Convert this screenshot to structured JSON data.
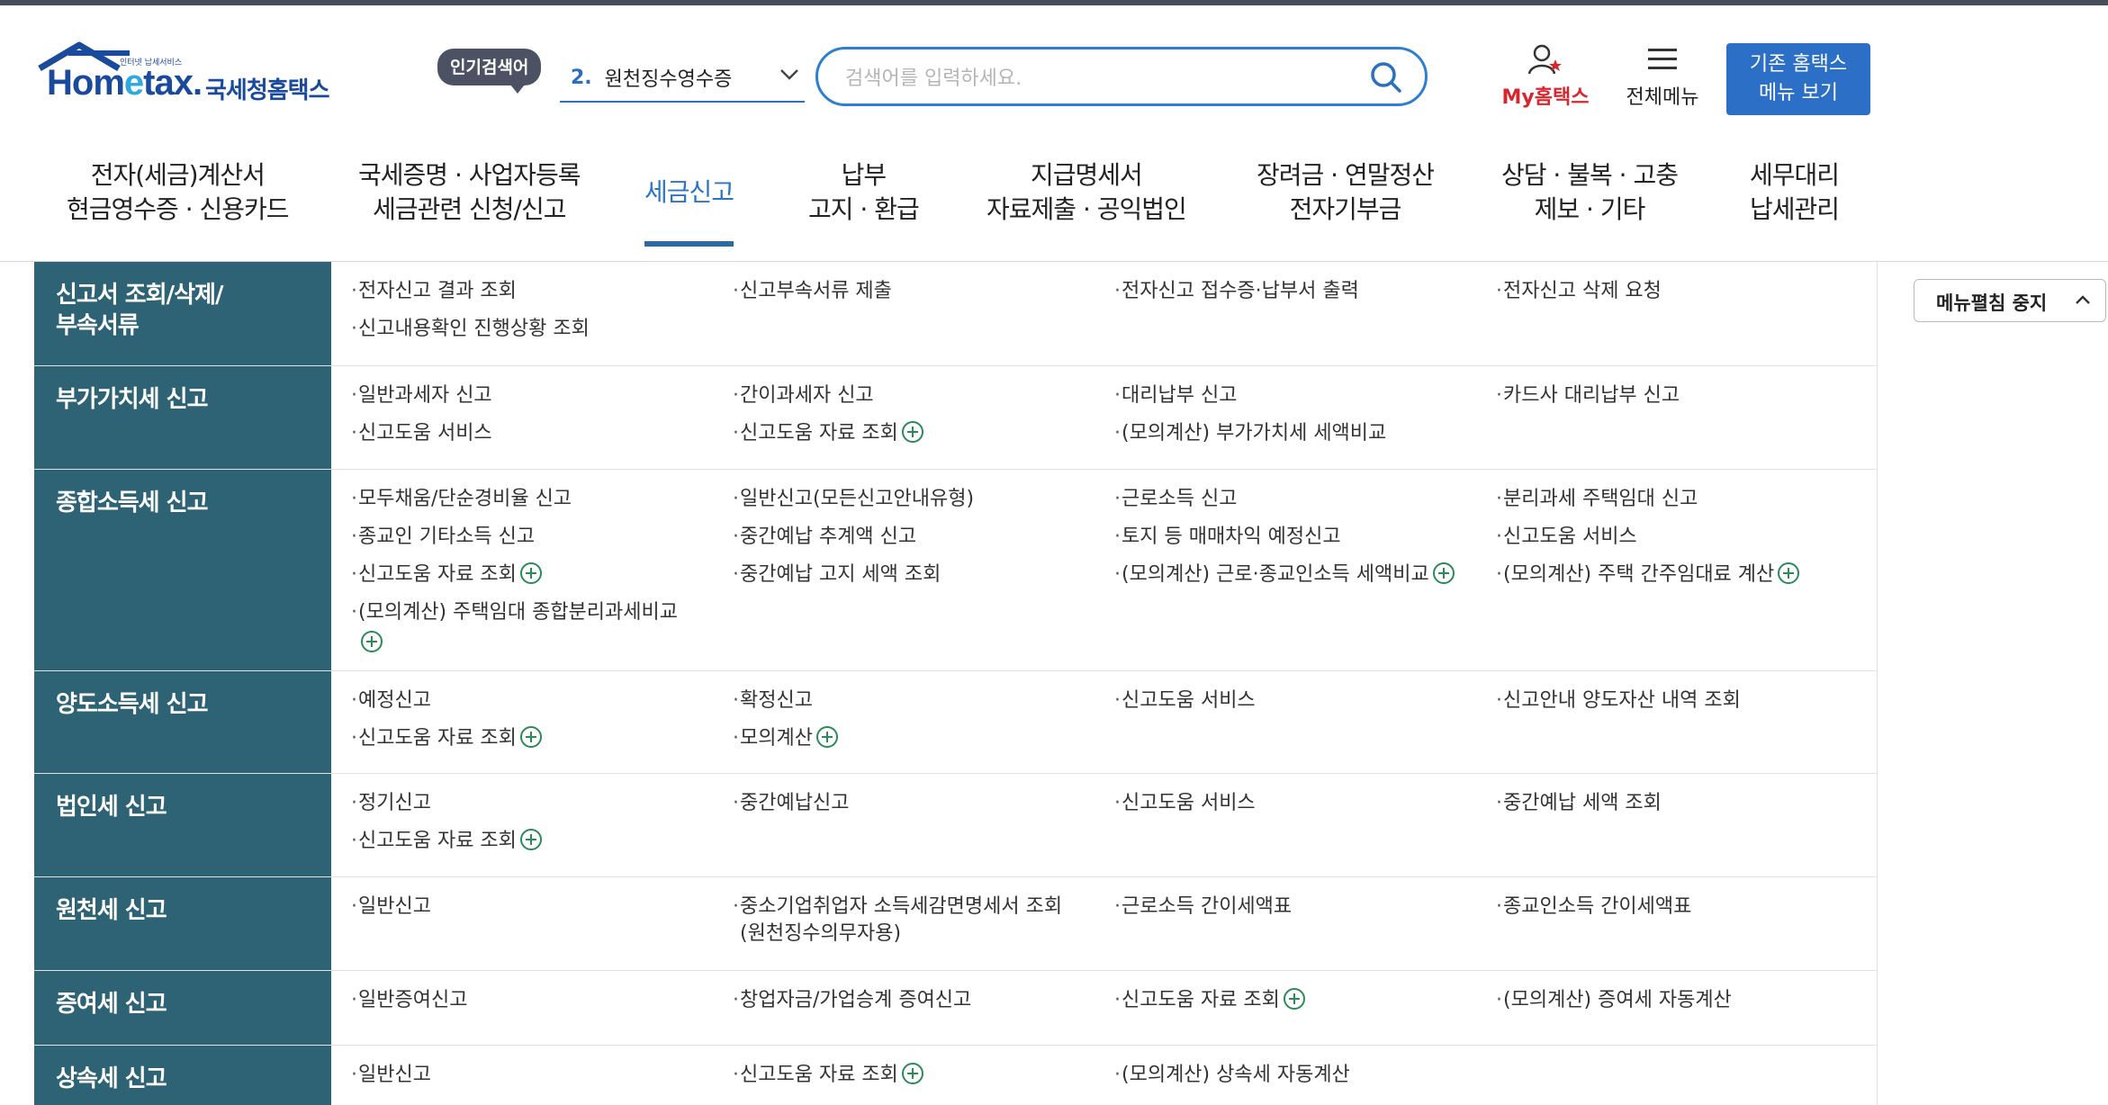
{
  "header": {
    "logo_small": "인터넷 납세서비스",
    "logo_word_1": "Hom",
    "logo_word_e": "e",
    "logo_word_2": "tax.",
    "logo_kname": "국세청홈택스",
    "popular_badge": "인기검색어",
    "popular_num": "2.",
    "popular_text": "원천징수영수증",
    "search_placeholder": "검색어를 입력하세요.",
    "my_hometax": "My홈택스",
    "all_menu": "전체메뉴",
    "old_home_line1": "기존 홈택스",
    "old_home_line2": "메뉴 보기"
  },
  "nav": [
    {
      "line1": "전자(세금)계산서",
      "line2": "현금영수증 · 신용카드"
    },
    {
      "line1": "국세증명 · 사업자등록",
      "line2": "세금관련 신청/신고"
    },
    {
      "line1": "세금신고",
      "line2": ""
    },
    {
      "line1": "납부",
      "line2": "고지 · 환급"
    },
    {
      "line1": "지급명세서",
      "line2": "자료제출 · 공익법인"
    },
    {
      "line1": "장려금 · 연말정산",
      "line2": "전자기부금"
    },
    {
      "line1": "상담 · 불복 · 고충",
      "line2": "제보 · 기타"
    },
    {
      "line1": "세무대리",
      "line2": "납세관리"
    }
  ],
  "menu_toggle": "메뉴펼침 중지",
  "rows": [
    {
      "title_1": "신고서 조회/삭제/",
      "title_2": "부속서류",
      "items": [
        {
          "text": "전자신고 결과 조회"
        },
        {
          "text": "신고부속서류 제출"
        },
        {
          "text": "전자신고 접수증·납부서 출력"
        },
        {
          "text": "전자신고 삭제 요청"
        },
        {
          "text": "신고내용확인 진행상황 조회"
        }
      ]
    },
    {
      "title_1": "부가가치세 신고",
      "items": [
        {
          "text": "일반과세자 신고"
        },
        {
          "text": "간이과세자 신고"
        },
        {
          "text": "대리납부 신고"
        },
        {
          "text": "카드사 대리납부 신고"
        },
        {
          "text": "신고도움 서비스"
        },
        {
          "text": "신고도움 자료 조회"
        },
        {
          "text": "(모의계산) 부가가치세 세액비교"
        }
      ]
    },
    {
      "title_1": "종합소득세 신고",
      "items": [
        {
          "text": "모두채움/단순경비율 신고"
        },
        {
          "text": "일반신고(모든신고안내유형)"
        },
        {
          "text": "근로소득 신고"
        },
        {
          "text": "분리과세 주택임대 신고"
        },
        {
          "text": "종교인 기타소득 신고"
        },
        {
          "text": "중간예납 추계액 신고"
        },
        {
          "text": "토지 등 매매차익 예정신고"
        },
        {
          "text": "신고도움 서비스"
        },
        {
          "text": "신고도움 자료 조회"
        },
        {
          "text": "중간예납 고지 세액 조회"
        },
        {
          "text": "(모의계산) 근로·종교인소득 세액비교"
        },
        {
          "text": "(모의계산) 주택 간주임대료 계산"
        },
        {
          "text": "(모의계산) 주택임대 종합분리과세비교"
        }
      ]
    },
    {
      "title_1": "양도소득세 신고",
      "items": [
        {
          "text": "예정신고"
        },
        {
          "text": "확정신고"
        },
        {
          "text": "신고도움 서비스"
        },
        {
          "text": "신고안내 양도자산 내역 조회"
        },
        {
          "text": "신고도움 자료 조회"
        },
        {
          "text": "모의계산"
        }
      ]
    },
    {
      "title_1": "법인세 신고",
      "items": [
        {
          "text": "정기신고"
        },
        {
          "text": "중간예납신고"
        },
        {
          "text": "신고도움 서비스"
        },
        {
          "text": "중간예납 세액 조회"
        },
        {
          "text": "신고도움 자료 조회"
        }
      ]
    },
    {
      "title_1": "원천세 신고",
      "items": [
        {
          "text": "일반신고"
        },
        {
          "text": "중소기업취업자 소득세감면명세서 조회",
          "text2": "(원천징수의무자용)"
        },
        {
          "text": "근로소득 간이세액표"
        },
        {
          "text": "종교인소득 간이세액표"
        }
      ]
    },
    {
      "title_1": "증여세 신고",
      "items": [
        {
          "text": "일반증여신고"
        },
        {
          "text": "창업자금/가업승계 증여신고"
        },
        {
          "text": "신고도움 자료 조회"
        },
        {
          "text": "(모의계산) 증여세 자동계산"
        }
      ]
    },
    {
      "title_1": "상속세 신고",
      "items": [
        {
          "text": "일반신고"
        },
        {
          "text": "신고도움 자료 조회"
        },
        {
          "text": "(모의계산) 상속세 자동계산"
        }
      ]
    }
  ]
}
